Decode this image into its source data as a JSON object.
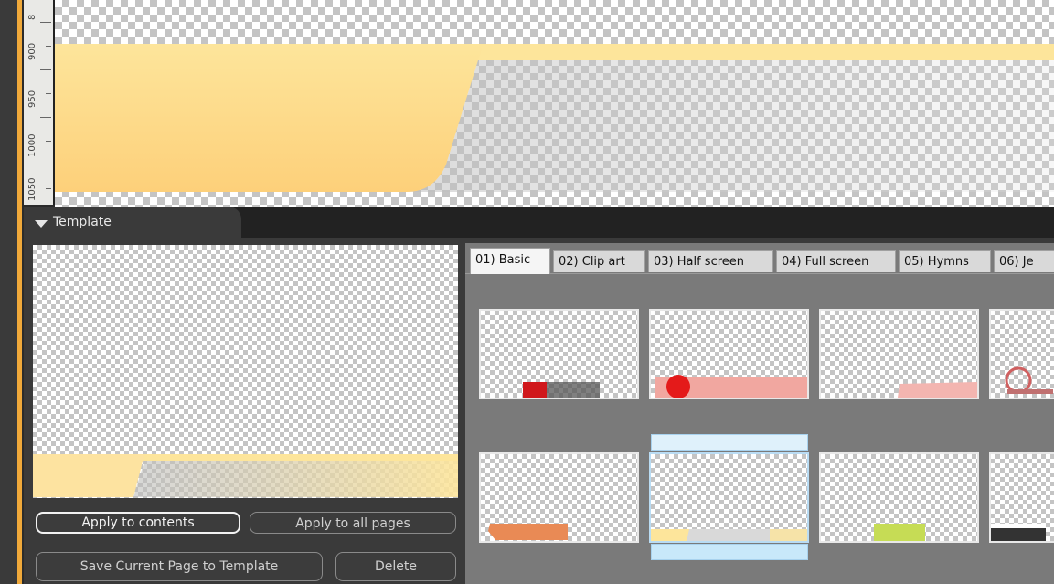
{
  "ruler": {
    "labels": [
      "8",
      "900",
      "950",
      "1000",
      "1050"
    ]
  },
  "template_panel": {
    "title": "Template"
  },
  "buttons": {
    "apply_contents": "Apply to contents",
    "apply_all": "Apply to all pages",
    "save_template": "Save Current Page to Template",
    "delete": "Delete"
  },
  "tabs": [
    {
      "label": "01) Basic",
      "active": true
    },
    {
      "label": "02) Clip art",
      "active": false
    },
    {
      "label": "03) Half screen",
      "active": false
    },
    {
      "label": "04) Full screen",
      "active": false
    },
    {
      "label": "05) Hymns",
      "active": false
    },
    {
      "label": "06) Je",
      "active": false
    }
  ],
  "colors": {
    "accent_orange": "#f0a93a",
    "banner_yellow": "#fddc8a",
    "selection_blue": "#b9dcf4"
  }
}
